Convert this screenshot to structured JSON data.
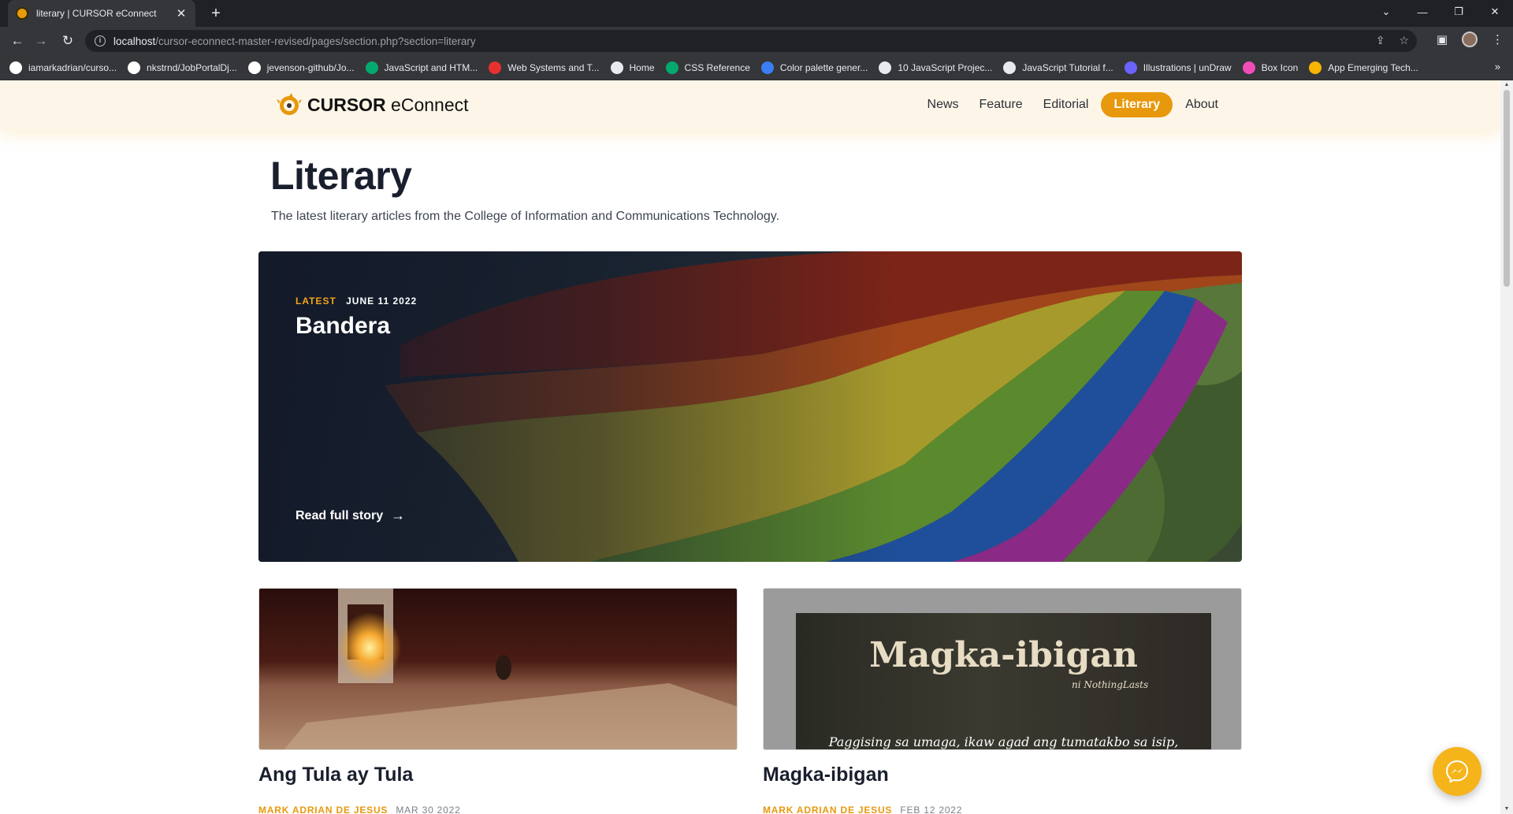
{
  "browser": {
    "tab_title": "literary | CURSOR eConnect",
    "tab_close": "✕",
    "new_tab": "+",
    "url_host": "localhost",
    "url_path": "/cursor-econnect-master-revised/pages/section.php?section=literary",
    "bookmarks": [
      {
        "label": "iamarkadrian/curso...",
        "icon": "github-icon",
        "color": "#ffffff"
      },
      {
        "label": "nkstrnd/JobPortalDj...",
        "icon": "github-icon",
        "color": "#ffffff"
      },
      {
        "label": "jevenson-github/Jo...",
        "icon": "github-icon",
        "color": "#ffffff"
      },
      {
        "label": "JavaScript and HTM...",
        "icon": "w3schools-icon",
        "color": "#04aa6d"
      },
      {
        "label": "Web Systems and T...",
        "icon": "opera-icon",
        "color": "#e8312f"
      },
      {
        "label": "Home",
        "icon": "home-favicon-icon",
        "color": "#e8eaed"
      },
      {
        "label": "CSS Reference",
        "icon": "w3schools-icon",
        "color": "#04aa6d"
      },
      {
        "label": "Color palette gener...",
        "icon": "coolors-icon",
        "color": "#3a7ef5"
      },
      {
        "label": "10 JavaScript Projec...",
        "icon": "gear-icon",
        "color": "#e8eaed"
      },
      {
        "label": "JavaScript Tutorial f...",
        "icon": "gear-icon",
        "color": "#e8eaed"
      },
      {
        "label": "Illustrations | unDraw",
        "icon": "undraw-icon",
        "color": "#6c63ff"
      },
      {
        "label": "Box Icon",
        "icon": "boxicons-icon",
        "color": "#f04db8"
      },
      {
        "label": "App Emerging Tech...",
        "icon": "drive-icon",
        "color": "#f7b500"
      }
    ],
    "bookmarks_more": "»"
  },
  "site": {
    "logo_bold": "CURSOR",
    "logo_light": " eConnect",
    "nav": [
      "News",
      "Feature",
      "Editorial",
      "Literary",
      "About"
    ],
    "active_nav": "Literary",
    "accent": "#e8980c"
  },
  "page": {
    "title": "Literary",
    "subtitle": "The latest literary articles from the College of Information and Communications Technology."
  },
  "hero": {
    "badge": "LATEST",
    "date": "JUNE 11 2022",
    "title": "Bandera",
    "link": "Read full story",
    "link_arrow": "→"
  },
  "cards": [
    {
      "title": "Ang Tula ay Tula",
      "author": "MARK ADRIAN DE JESUS",
      "date": "MAR 30 2022"
    },
    {
      "title": "Magka-ibigan",
      "author": "MARK ADRIAN DE JESUS",
      "date": "FEB 12 2022",
      "image_title": "Magka-ibigan",
      "image_byline": "ni NothingLasts",
      "image_caption": "Paggising sa umaga, ikaw agad ang tumatakbo sa isip,"
    }
  ]
}
